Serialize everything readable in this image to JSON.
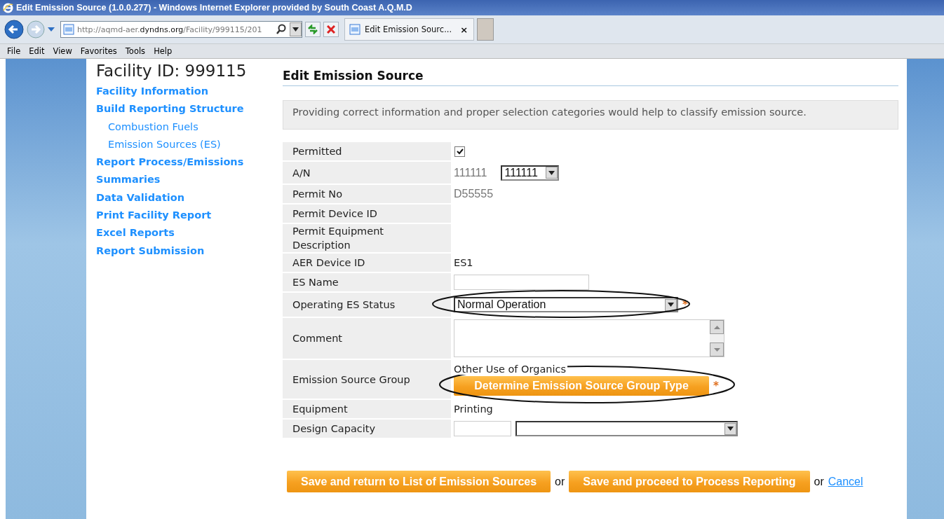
{
  "window": {
    "title": "Edit Emission Source (1.0.0.277) - Windows Internet Explorer provided by South Coast A.Q.M.D"
  },
  "address_bar": {
    "url_start": "http://aqmd-aer.",
    "url_domain": "dyndns.org",
    "url_end": "/Facility/999115/201"
  },
  "tab": {
    "label": "Edit Emission Sourc...",
    "close": "×"
  },
  "menu": [
    "File",
    "Edit",
    "View",
    "Favorites",
    "Tools",
    "Help"
  ],
  "sidebar": {
    "title": "Facility ID: 999115",
    "items": [
      {
        "label": "Facility Information"
      },
      {
        "label": "Build Reporting Structure",
        "children": [
          {
            "label": "Combustion Fuels"
          },
          {
            "label": "Emission Sources (ES)"
          }
        ]
      },
      {
        "label": "Report Process/Emissions"
      },
      {
        "label": "Summaries"
      },
      {
        "label": "Data Validation"
      },
      {
        "label": "Print Facility Report"
      },
      {
        "label": "Excel Reports"
      },
      {
        "label": "Report Submission"
      }
    ]
  },
  "main": {
    "heading": "Edit Emission Source",
    "notice": "Providing correct information and proper selection categories would help to classify emission source.",
    "rows": [
      {
        "label": "Permitted",
        "kind": "checkbox",
        "checked": true
      },
      {
        "label": "A/N",
        "kind": "text-select",
        "text": "111111",
        "muted": true,
        "value": "111111"
      },
      {
        "label": "Permit No",
        "kind": "text",
        "text": "D55555",
        "muted": true
      },
      {
        "label": "Permit Device ID",
        "kind": "empty"
      },
      {
        "label": "Permit Equipment Description",
        "kind": "empty"
      },
      {
        "label": "AER Device ID",
        "kind": "text",
        "text": "ES1",
        "muted": false
      },
      {
        "label": "ES Name",
        "kind": "input"
      },
      {
        "label": "Operating ES Status",
        "kind": "select",
        "value": "Normal Operation",
        "required_mark": "*",
        "circled": true
      },
      {
        "label": "Comment",
        "kind": "textarea"
      },
      {
        "label": "Emission Source Group",
        "kind": "group",
        "text": "Other Use of Organics",
        "button": "Determine Emission Source Group Type",
        "required_mark": "*",
        "circled": true
      },
      {
        "label": "Equipment",
        "kind": "text",
        "text": "Printing",
        "muted": false
      },
      {
        "label": "Design Capacity",
        "kind": "input-select"
      }
    ]
  },
  "actions": [
    {
      "kind": "button",
      "label": "Save and return to List of Emission Sources"
    },
    {
      "kind": "text",
      "label": "or"
    },
    {
      "kind": "button",
      "label": "Save and proceed to Process Reporting"
    },
    {
      "kind": "text",
      "label": "or"
    },
    {
      "kind": "link",
      "label": "Cancel"
    }
  ]
}
